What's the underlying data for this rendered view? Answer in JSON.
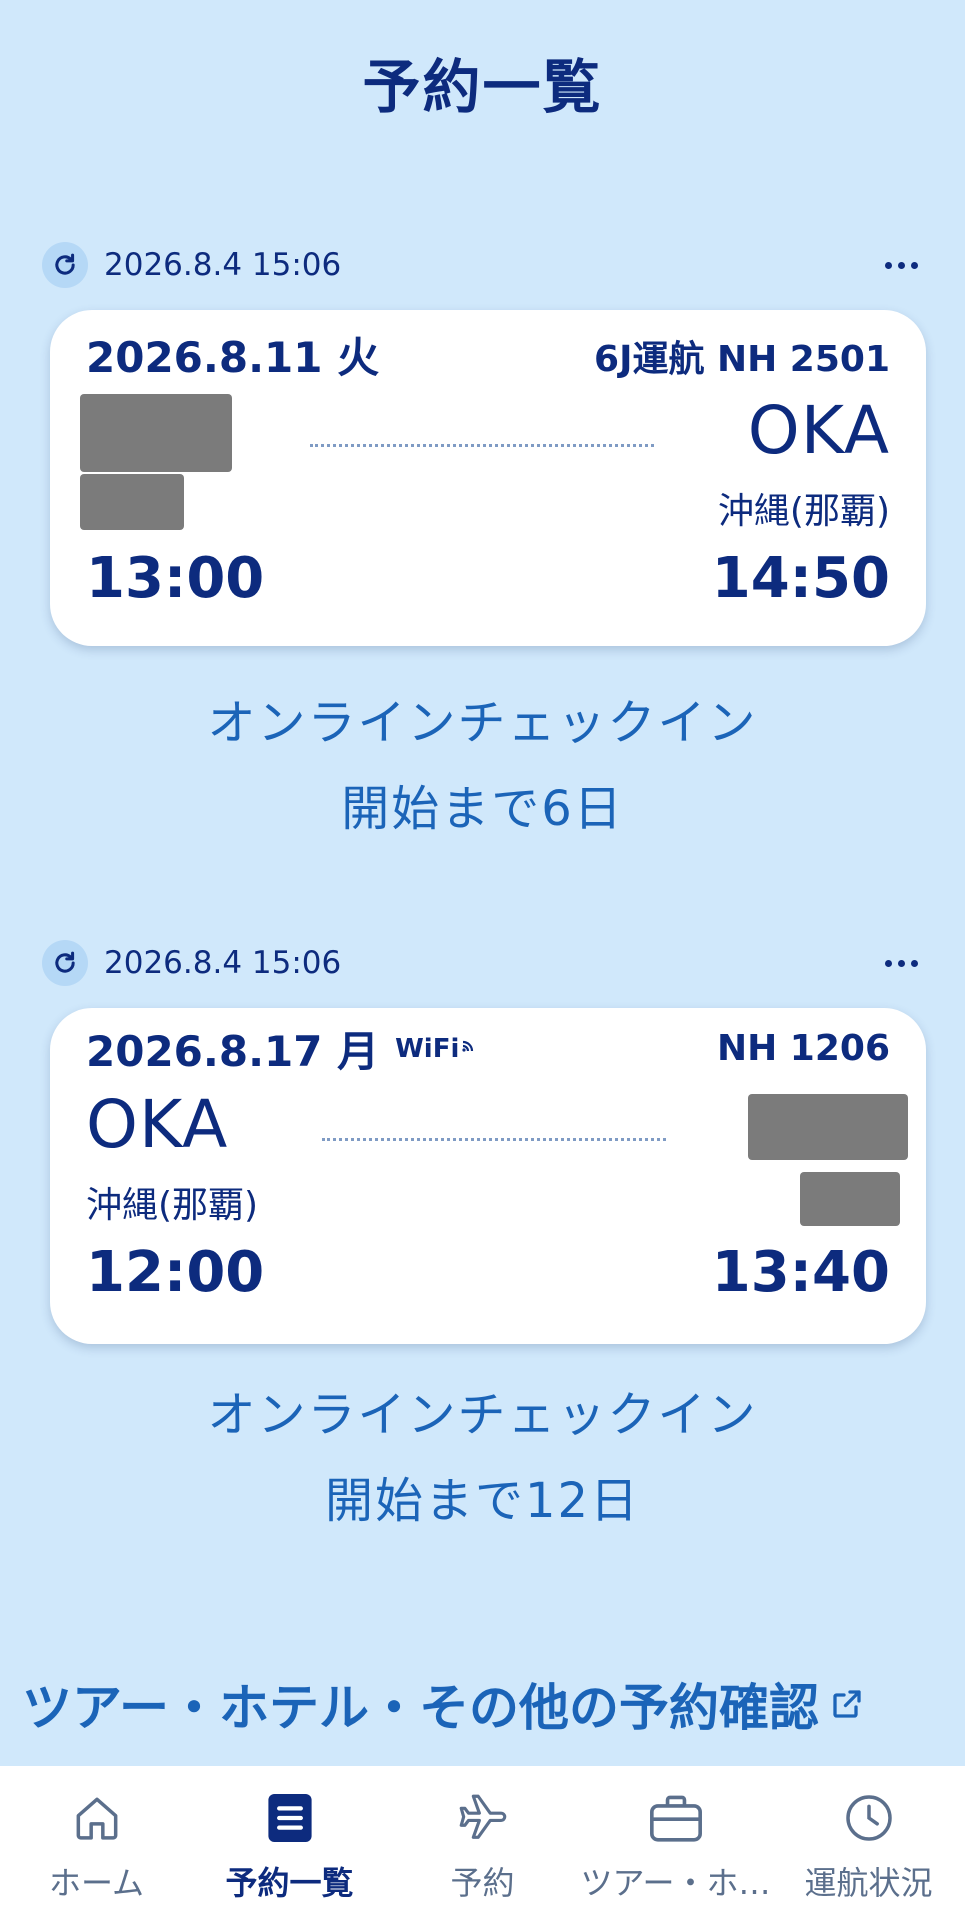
{
  "page": {
    "title": "予約一覧"
  },
  "bookings": [
    {
      "updated": "2026.8.4 15:06",
      "date": "2026.8.11 火",
      "flight": "6J運航 NH 2501",
      "wifi": "",
      "dep": {
        "code": "",
        "name": "",
        "time": "13:00"
      },
      "arr": {
        "code": "OKA",
        "name": "沖縄(那覇)",
        "time": "14:50"
      },
      "checkin_line1": "オンラインチェックイン",
      "checkin_line2": "開始まで6日"
    },
    {
      "updated": "2026.8.4 15:06",
      "date": "2026.8.17 月",
      "flight": "NH 1206",
      "wifi": "WiFi",
      "dep": {
        "code": "OKA",
        "name": "沖縄(那覇)",
        "time": "12:00"
      },
      "arr": {
        "code": "",
        "name": "",
        "time": "13:40"
      },
      "checkin_line1": "オンラインチェックイン",
      "checkin_line2": "開始まで12日"
    }
  ],
  "other_reservations": {
    "label": "ツアー・ホテル・その他の予約確認",
    "icon": "external-link-icon"
  },
  "tabbar": {
    "items": [
      {
        "label": "ホーム",
        "icon": "home-icon",
        "active": false
      },
      {
        "label": "予約一覧",
        "icon": "list-icon",
        "active": true
      },
      {
        "label": "予約",
        "icon": "airplane-icon",
        "active": false
      },
      {
        "label": "ツアー・ホ…",
        "icon": "suitcase-icon",
        "active": false
      },
      {
        "label": "運航状況",
        "icon": "clock-icon",
        "active": false
      }
    ]
  },
  "colors": {
    "background": "#d0e8fb",
    "primary": "#0d2b7e",
    "link": "#1b64b8",
    "redaction": "#7b7b7b"
  }
}
